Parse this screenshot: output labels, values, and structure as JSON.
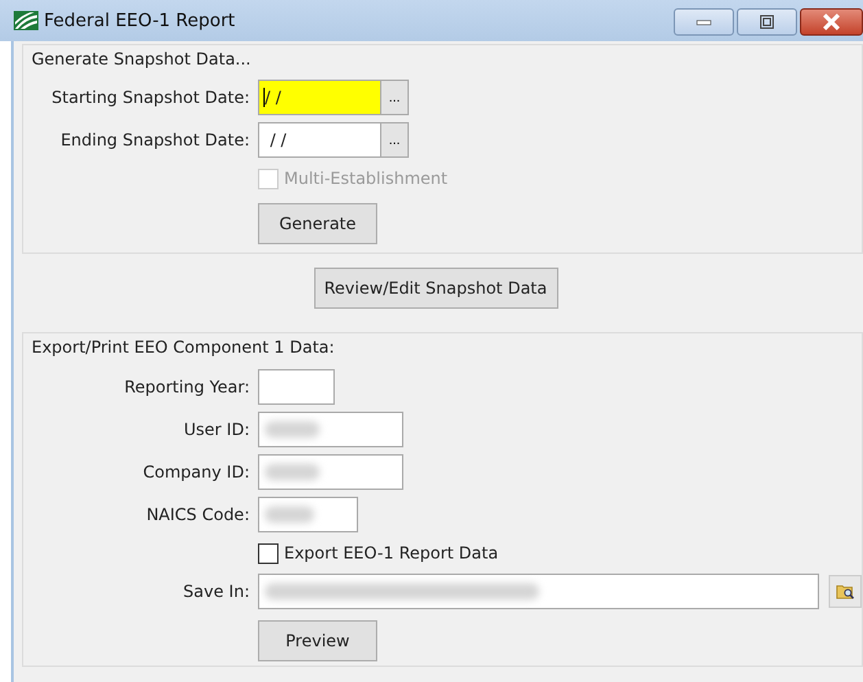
{
  "window": {
    "title": "Federal EEO-1 Report"
  },
  "snapshot_group": {
    "title": "Generate Snapshot Data...",
    "fields": [
      {
        "label": "Starting Snapshot Date:",
        "value": "/ /",
        "focused": true,
        "picker_button": "..."
      },
      {
        "label": "Ending Snapshot Date:",
        "value": " / /",
        "focused": false,
        "picker_button": "..."
      }
    ],
    "multi_establishment": {
      "label": "Multi-Establishment",
      "checked": false,
      "disabled": true
    },
    "generate_button": "Generate"
  },
  "review_button": "Review/Edit Snapshot Data",
  "export_group": {
    "title": "Export/Print EEO Component 1 Data:",
    "fields": [
      {
        "label": "Reporting Year:",
        "kind": "short",
        "blurred": false
      },
      {
        "label": "User ID:",
        "kind": "long",
        "blurred": true
      },
      {
        "label": "Company ID:",
        "kind": "long",
        "blurred": true
      },
      {
        "label": "NAICS Code:",
        "kind": "medium",
        "blurred": true
      }
    ],
    "export_checkbox": {
      "label": "Export EEO-1 Report Data",
      "checked": false,
      "disabled": false
    },
    "save_in": {
      "label": "Save In:",
      "blurred": true
    },
    "preview_button": "Preview"
  }
}
